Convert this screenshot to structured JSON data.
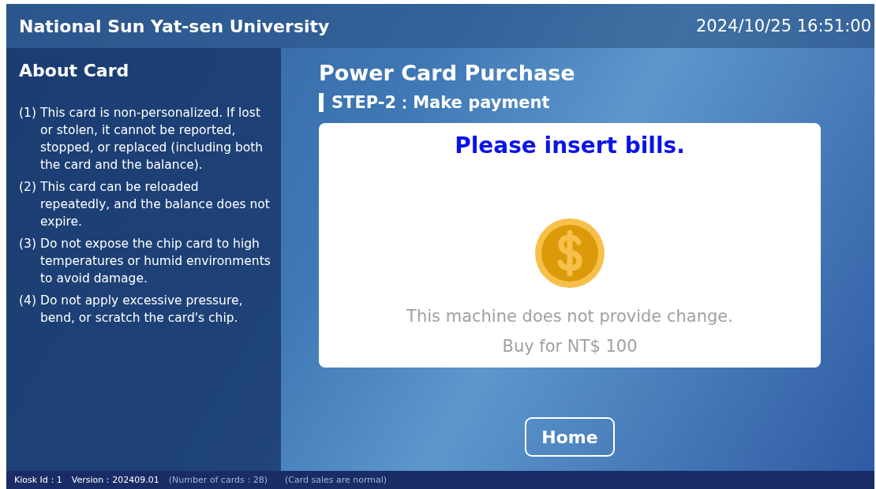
{
  "header": {
    "title": "National Sun Yat-sen University",
    "datetime": "2024/10/25 16:51:00"
  },
  "sidebar": {
    "title": "About Card",
    "items": [
      {
        "number": "(1)",
        "text": "This card is non-personalized. If lost or stolen, it cannot be reported, stopped, or replaced (including both the card and the balance)."
      },
      {
        "number": "(2)",
        "text": "This card can be reloaded repeatedly, and the balance does not expire."
      },
      {
        "number": "(3)",
        "text": "Do not expose the chip card to high temperatures or humid environments to avoid damage."
      },
      {
        "number": "(4)",
        "text": "Do not apply excessive pressure, bend, or scratch the card's chip."
      }
    ]
  },
  "main": {
    "title": "Power Card Purchase",
    "step": "STEP-2：Make payment",
    "card": {
      "prompt": "Please insert bills.",
      "notice": "This machine does not provide change.",
      "amount": "Buy for NT$ 100"
    },
    "buttons": [
      "Home"
    ]
  },
  "status_bar": [
    "Kiosk Id：1",
    "Version：202409.01",
    "(Number of cards：28)",
    "(Card sales are normal)"
  ]
}
